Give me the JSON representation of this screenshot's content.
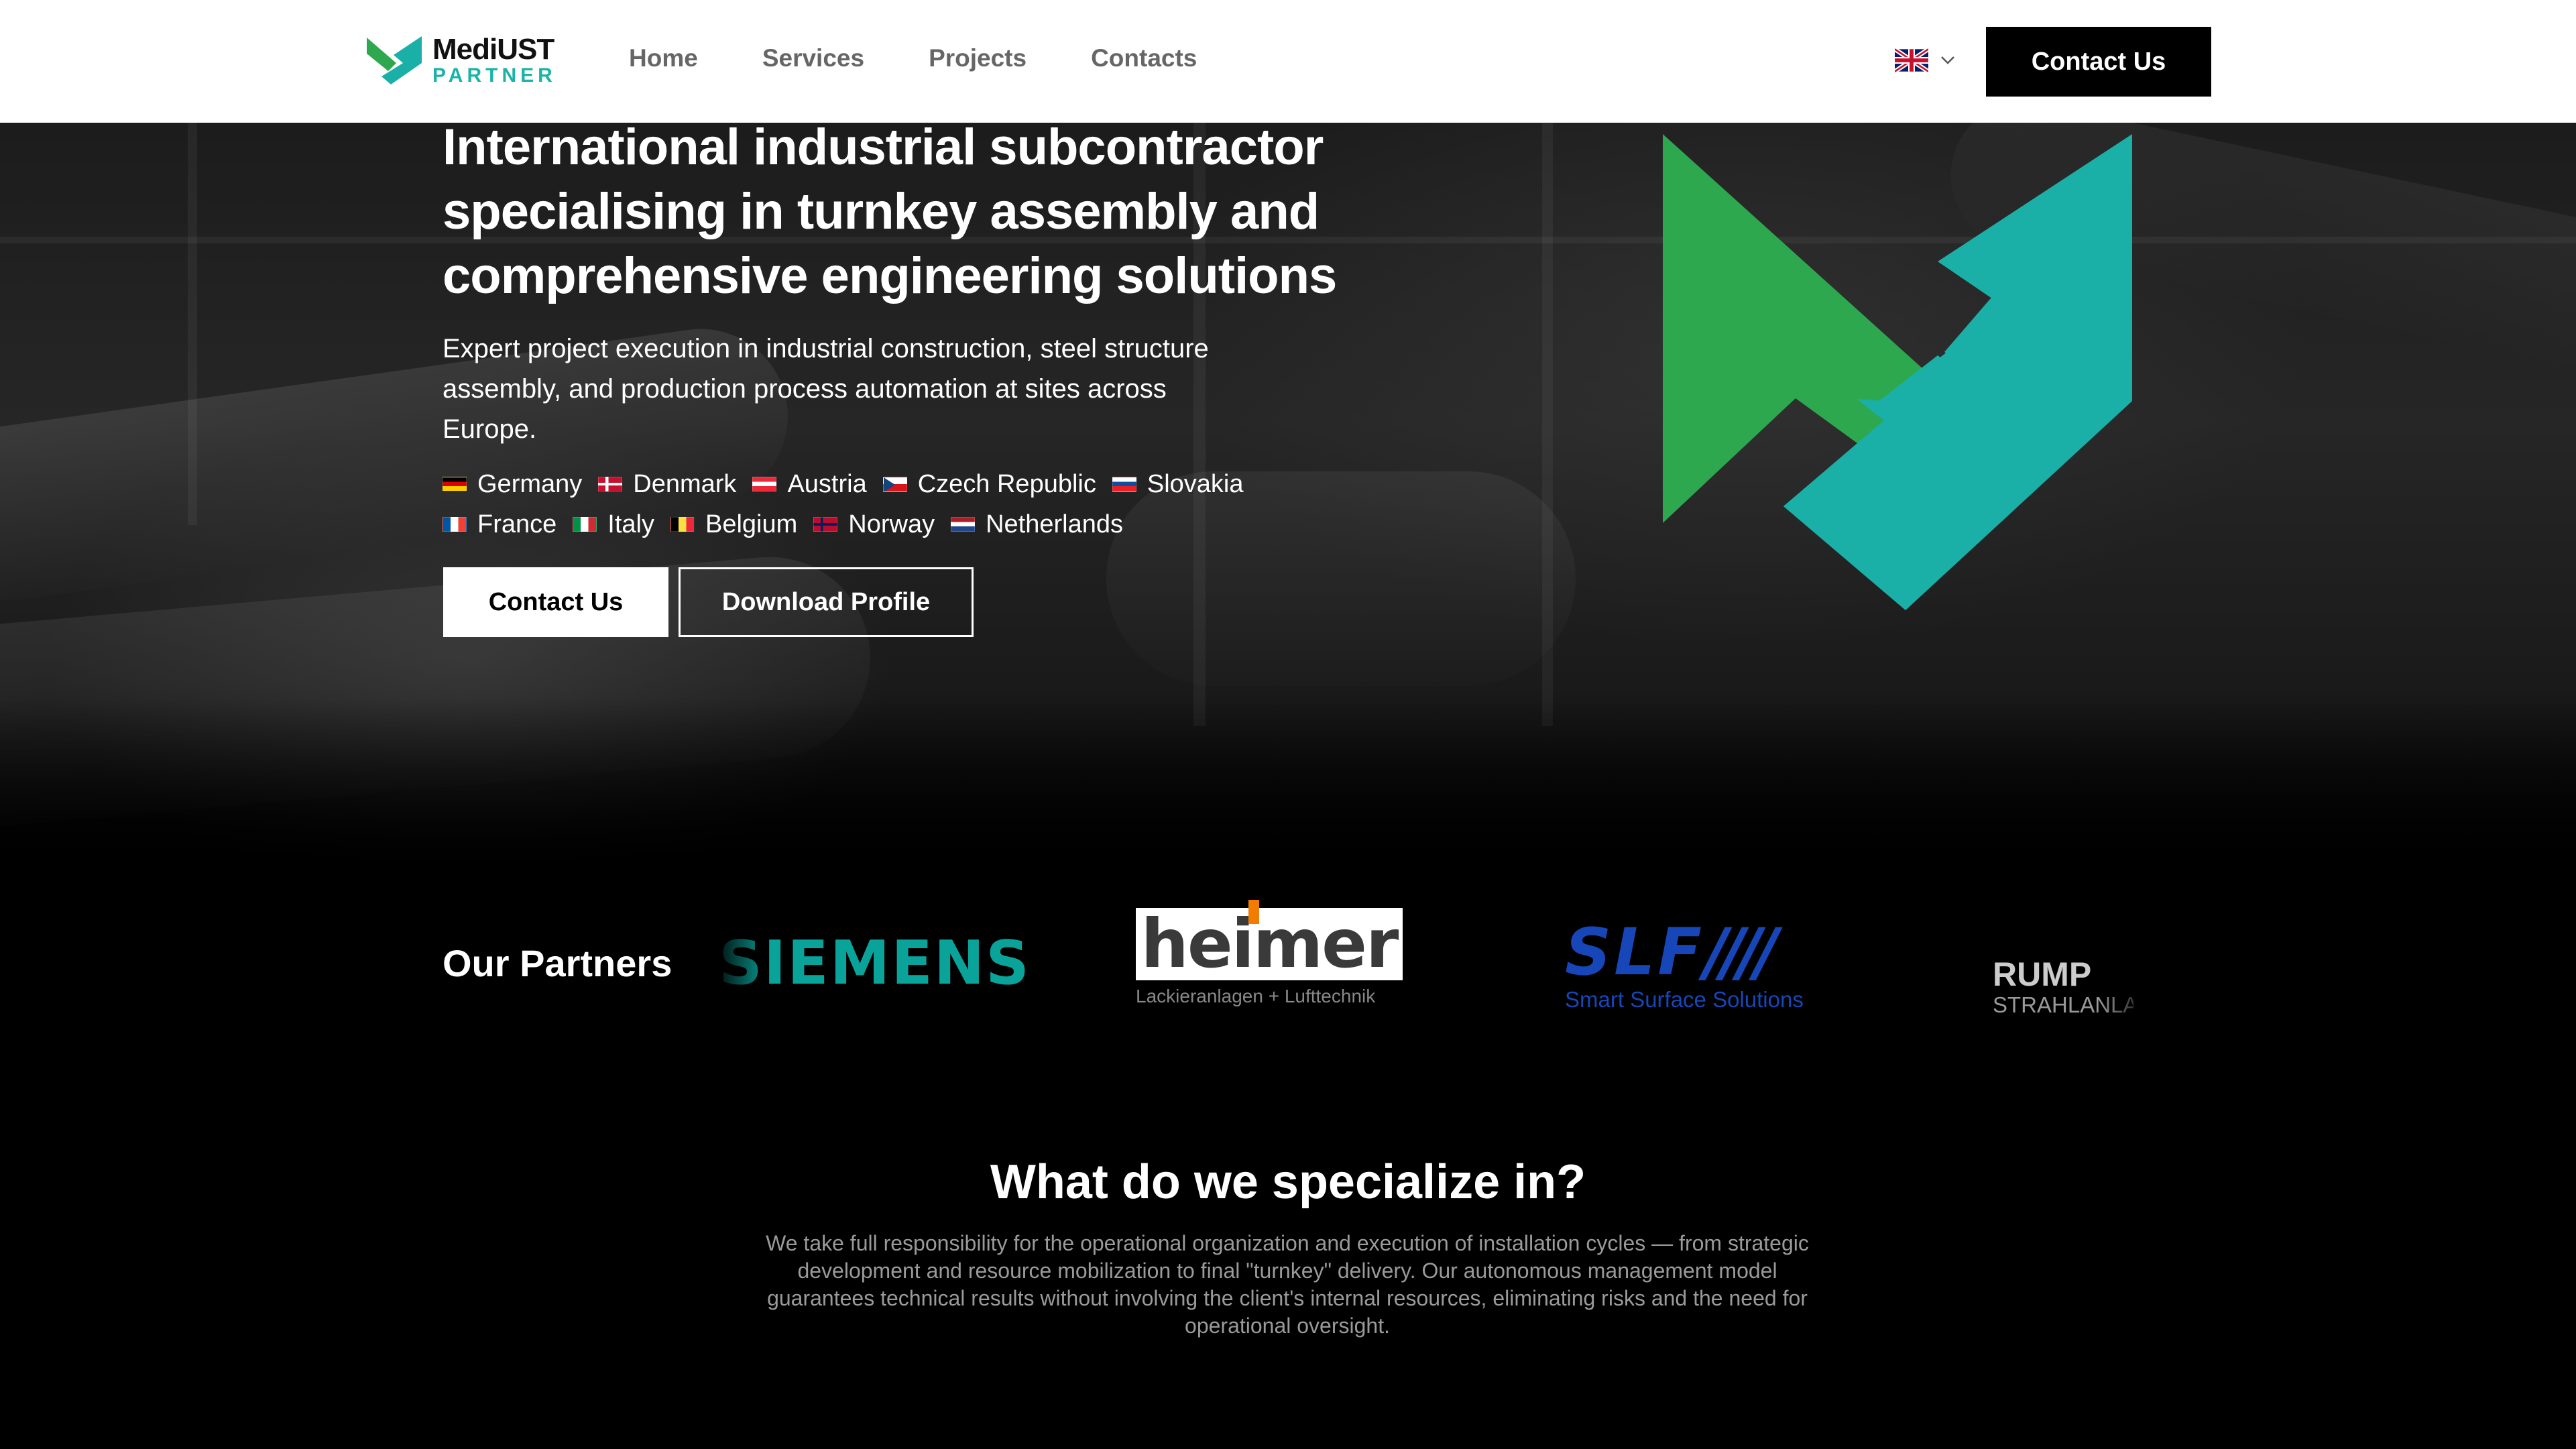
{
  "header": {
    "logo": {
      "name": "MediUST",
      "sub": "PARTNER"
    },
    "nav": [
      {
        "label": "Home"
      },
      {
        "label": "Services"
      },
      {
        "label": "Projects"
      },
      {
        "label": "Contacts"
      }
    ],
    "language_icon": "uk-flag-icon",
    "cta_label": "Contact Us"
  },
  "hero": {
    "title": "International industrial subcontractor specialising in turnkey assembly and comprehensive engineering solutions",
    "description": "Expert project execution in industrial construction, steel structure assembly, and production process automation at sites across Europe.",
    "countries": [
      {
        "name": "Germany",
        "flag_colors": [
          "#000000",
          "#dd0000",
          "#ffce00"
        ]
      },
      {
        "name": "Denmark",
        "flag_colors": [
          "#c8102e",
          "#ffffff"
        ]
      },
      {
        "name": "Austria",
        "flag_colors": [
          "#ed2939",
          "#ffffff",
          "#ed2939"
        ]
      },
      {
        "name": "Czech Republic",
        "flag_colors": [
          "#ffffff",
          "#d7141a",
          "#11457e"
        ]
      },
      {
        "name": "Slovakia",
        "flag_colors": [
          "#ffffff",
          "#0b4ea2",
          "#ee1c25"
        ]
      },
      {
        "name": "France",
        "flag_colors": [
          "#0055a4",
          "#ffffff",
          "#ef4135"
        ]
      },
      {
        "name": "Italy",
        "flag_colors": [
          "#009246",
          "#ffffff",
          "#ce2b37"
        ]
      },
      {
        "name": "Belgium",
        "flag_colors": [
          "#000000",
          "#fae042",
          "#ed2939"
        ]
      },
      {
        "name": "Norway",
        "flag_colors": [
          "#ba0c2f",
          "#ffffff",
          "#00205b"
        ]
      },
      {
        "name": "Netherlands",
        "flag_colors": [
          "#ae1c28",
          "#ffffff",
          "#21468b"
        ]
      }
    ],
    "primary_button": "Contact Us",
    "secondary_button": "Download Profile",
    "brand_colors": {
      "green": "#2ea84f",
      "teal": "#1ab0a8"
    }
  },
  "partners": {
    "title": "Our Partners",
    "items": [
      {
        "name": "SIEMENS"
      },
      {
        "name": "heimer",
        "tagline": "Lackieranlagen + Lufttechnik"
      },
      {
        "name": "SLF",
        "tagline": "Smart Surface Solutions"
      },
      {
        "name": "RUMP",
        "tagline": "STRAHLANLA"
      }
    ]
  },
  "specialize": {
    "title": "What do we specialize in?",
    "text": "We take full responsibility for the operational organization and execution of installation cycles — from strategic development and resource mobilization to final \"turnkey\" delivery. Our autonomous management model guarantees technical results without involving the client's internal resources, eliminating risks and the need for operational oversight."
  }
}
